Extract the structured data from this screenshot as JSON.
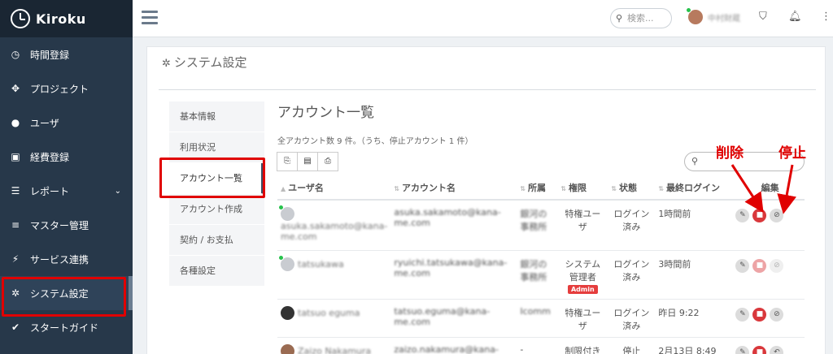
{
  "app": {
    "name": "Kiroku"
  },
  "sidebar": {
    "items": [
      {
        "icon": "clock-icon",
        "glyph": "◷",
        "label": "時間登録"
      },
      {
        "icon": "cubes-icon",
        "glyph": "✥",
        "label": "プロジェクト"
      },
      {
        "icon": "user-icon",
        "glyph": "●",
        "label": "ユーザ"
      },
      {
        "icon": "bus-icon",
        "glyph": "▣",
        "label": "経費登録"
      },
      {
        "icon": "list-icon",
        "glyph": "☰",
        "label": "レポート",
        "chevron": "⌄"
      },
      {
        "icon": "database-icon",
        "glyph": "≡",
        "label": "マスター管理"
      },
      {
        "icon": "plug-icon",
        "glyph": "⚡",
        "label": "サービス連携"
      },
      {
        "icon": "gear-icon",
        "glyph": "✲",
        "label": "システム設定"
      },
      {
        "icon": "check-icon",
        "glyph": "✔",
        "label": "スタートガイド"
      }
    ]
  },
  "topbar": {
    "search_placeholder": "検索...",
    "user_name": "中村財蔵"
  },
  "panel": {
    "title": "システム設定",
    "subnav": [
      "基本情報",
      "利用状況",
      "アカウント一覧",
      "アカウント作成",
      "契約 / お支払",
      "各種設定"
    ],
    "list_title": "アカウント一覧",
    "summary": "全アカウント数 9 件。（うち、停止アカウント 1 件）",
    "tool_buttons": [
      {
        "icon": "copy-icon",
        "glyph": "⎘"
      },
      {
        "icon": "csv-icon",
        "glyph": "▤"
      },
      {
        "icon": "print-icon",
        "glyph": "⎙"
      }
    ]
  },
  "annotations": {
    "delete": "削除",
    "suspend": "停止"
  },
  "table": {
    "headers": [
      "ユーザ名",
      "アカウント名",
      "所属",
      "権限",
      "状態",
      "最終ログイン",
      "編集"
    ],
    "rows": [
      {
        "user": "asuka.sakamoto@kana-me.com",
        "account": "asuka.sakamoto@kana-me.com",
        "dept": "銀河の事務所",
        "role": "特権ユーザ",
        "badge": "",
        "status": "ログイン済み",
        "last_login": "1時間前",
        "actions": [
          "edit",
          "delete",
          "suspend"
        ]
      },
      {
        "user": "tatsukawa",
        "account": "ryuichi.tatsukawa@kana-me.com",
        "dept": "銀河の事務所",
        "role": "システム管理者",
        "badge": "Admin",
        "status": "ログイン済み",
        "last_login": "3時間前",
        "actions": [
          "edit",
          "delete",
          "suspend"
        ]
      },
      {
        "user": "tatsuo eguma",
        "account": "tatsuo.eguma@kana-me.com",
        "dept": "Icomm",
        "role": "特権ユーザ",
        "badge": "",
        "status": "ログイン済み",
        "last_login": "昨日 9:22",
        "actions": [
          "edit",
          "delete",
          "suspend"
        ]
      },
      {
        "user": "Zaizo Nakamura",
        "account": "zaizo.nakamura@kana-me.com",
        "dept": "-",
        "role": "制限付き",
        "badge": "",
        "status": "停止",
        "last_login": "2月13日 8:49",
        "actions": [
          "edit",
          "delete",
          "restore"
        ]
      }
    ]
  }
}
